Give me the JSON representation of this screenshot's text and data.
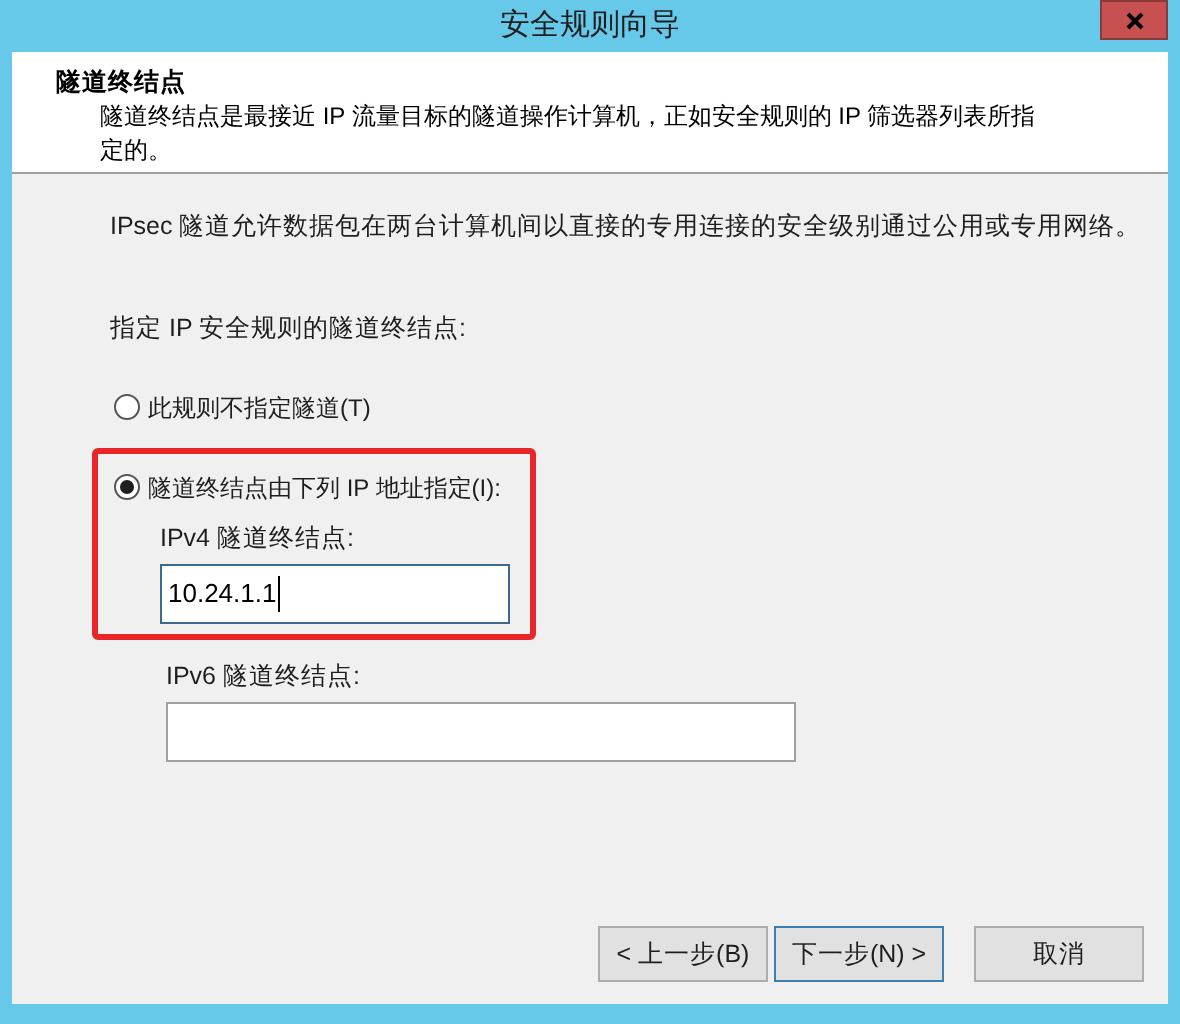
{
  "window": {
    "title": "安全规则向导"
  },
  "header": {
    "title": "隧道终结点",
    "description": "隧道终结点是最接近 IP 流量目标的隧道操作计算机，正如安全规则的 IP 筛选器列表所指定的。"
  },
  "intro": "IPsec 隧道允许数据包在两台计算机间以直接的专用连接的安全级别通过公用或专用网络。",
  "prompt": "指定 IP 安全规则的隧道终结点:",
  "choices": [
    {
      "label": "此规则不指定隧道(T)",
      "selected": false,
      "highlighted": false
    },
    {
      "label": "隧道终结点由下列 IP 地址指定(I):",
      "selected": true,
      "highlighted": true,
      "fields": [
        {
          "label": "IPv4 隧道终结点:",
          "value": "10.24.1.1",
          "focused": true
        }
      ]
    }
  ],
  "extra_fields": [
    {
      "label": "IPv6 隧道终结点:",
      "focused": false
    }
  ],
  "buttons": [
    {
      "label": "< 上一步(B)",
      "default": false
    },
    {
      "label": "下一步(N) >",
      "default": true
    },
    {
      "label": "取消",
      "default": false
    }
  ]
}
